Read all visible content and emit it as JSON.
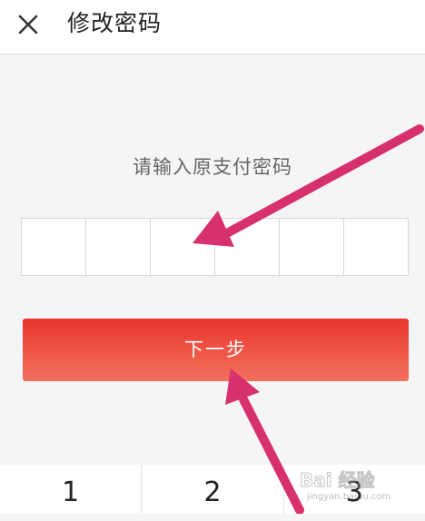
{
  "header": {
    "close_icon": "close-icon",
    "title": "修改密码"
  },
  "main": {
    "prompt": "请输入原支付密码",
    "pin_length": 6,
    "next_button_label": "下一步"
  },
  "keypad": {
    "keys": [
      "1",
      "2",
      "3"
    ]
  },
  "watermark": {
    "logo": "Bai 经验",
    "url": "jingyan.baidu.com"
  },
  "colors": {
    "button_red": "#e8352f",
    "button_red_light": "#f0705c",
    "annotation_pink": "#d6306e",
    "background": "#f5f5f5"
  }
}
